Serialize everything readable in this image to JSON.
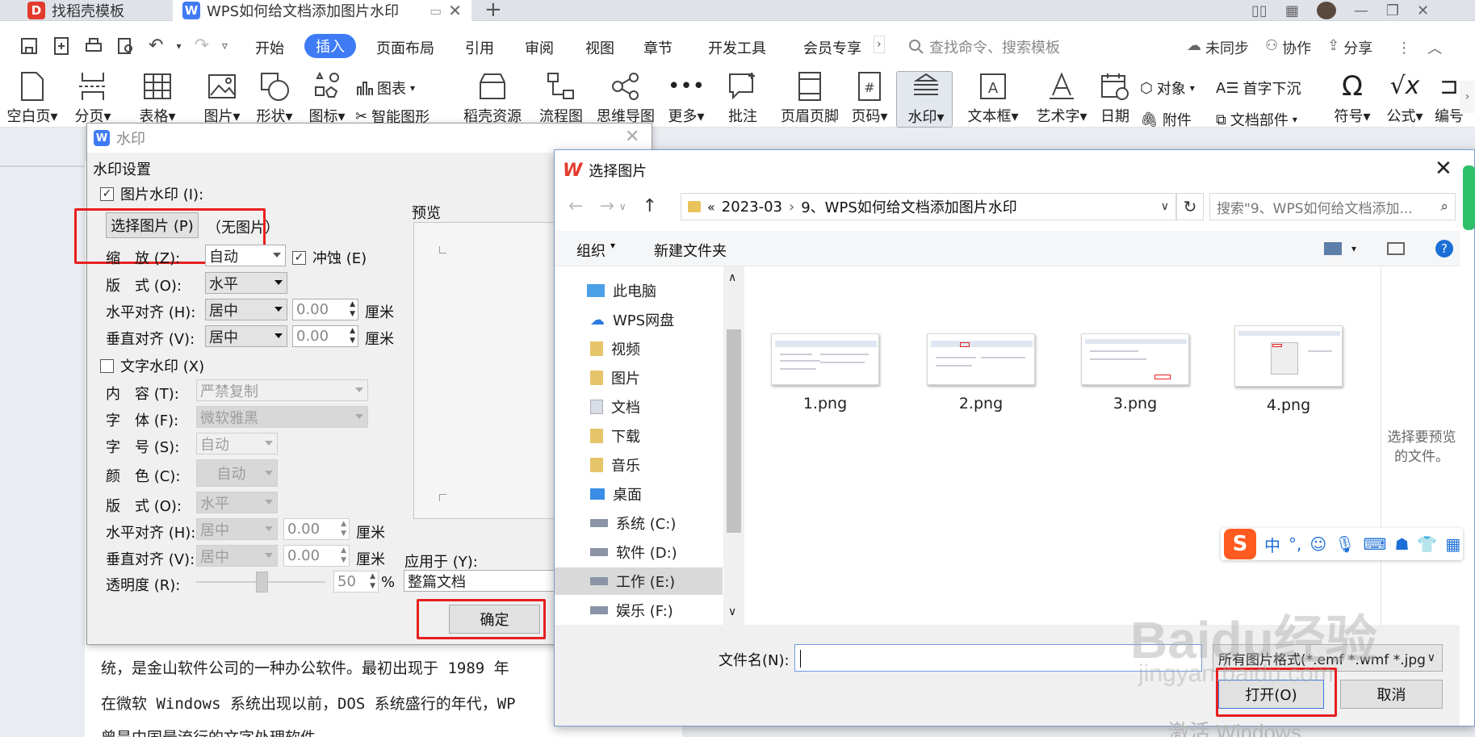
{
  "tabs": [
    {
      "label": "找稻壳模板",
      "logo": "D"
    },
    {
      "label": "WPS如何给文档添加图片水印",
      "logo": "W"
    }
  ],
  "new_tab": "+",
  "menu": [
    "开始",
    "插入",
    "页面布局",
    "引用",
    "审阅",
    "视图",
    "章节",
    "开发工具",
    "会员专享"
  ],
  "menu_active": "插入",
  "search": {
    "placeholder": "查找命令、搜索模板"
  },
  "top_right": {
    "sync": "未同步",
    "collab": "协作",
    "share": "分享"
  },
  "ribbon": {
    "blank_page": "空白页",
    "section": "分页",
    "table": "表格",
    "picture": "图片",
    "shape": "形状",
    "icon": "图标",
    "chart": "图表",
    "smart_graph": "智能图形",
    "docer_res": "稻壳资源",
    "flowchart": "流程图",
    "mindmap": "思维导图",
    "more": "更多",
    "comment": "批注",
    "header_footer": "页眉页脚",
    "page_num": "页码",
    "watermark": "水印",
    "textbox": "文本框",
    "wordart": "艺术字",
    "date": "日期",
    "object": "对象",
    "attachment": "附件",
    "drop_cap": "首字下沉",
    "doc_parts": "文档部件",
    "symbol": "符号",
    "formula": "公式",
    "edit": "编号"
  },
  "watermark_dialog": {
    "title": "水印",
    "settings_label": "水印设置",
    "pic_wm_label": "图片水印 (I):",
    "select_pic_btn": "选择图片 (P)",
    "no_pic": "（无图片）",
    "scale_label": "缩　放 (Z):",
    "scale_value": "自动",
    "washout_label": "冲蚀 (E)",
    "layout_label": "版　式 (O):",
    "layout_value": "水平",
    "halign_label": "水平对齐 (H):",
    "halign_value": "居中",
    "h_offset": "0.00",
    "unit_cm": "厘米",
    "valign_label": "垂直对齐 (V):",
    "valign_value": "居中",
    "v_offset": "0.00",
    "text_wm_label": "文字水印 (X)",
    "content_label": "内　容 (T):",
    "content_value": "严禁复制",
    "font_label": "字　体 (F):",
    "font_value": "微软雅黑",
    "size_label": "字　号 (S):",
    "size_value": "自动",
    "color_label": "颜　色 (C):",
    "color_value": "自动",
    "t_layout_label": "版　式 (O):",
    "t_layout_value": "水平",
    "t_halign_label": "水平对齐 (H):",
    "t_halign_value": "居中",
    "t_h_offset": "0.00",
    "t_valign_label": "垂直对齐 (V):",
    "t_valign_value": "居中",
    "t_v_offset": "0.00",
    "opacity_label": "透明度 (R):",
    "opacity_value": "50",
    "opacity_unit": "%",
    "preview_label": "预览",
    "apply_label": "应用于 (Y):",
    "apply_value": "整篇文档",
    "ok_btn": "确定"
  },
  "file_dialog": {
    "title": "选择图片",
    "breadcrumb": [
      "«",
      "2023-03",
      "9、WPS如何给文档添加图片水印"
    ],
    "search_placeholder": "搜索\"9、WPS如何给文档添加...",
    "organize": "组织",
    "new_folder": "新建文件夹",
    "nav": [
      {
        "label": "此电脑",
        "icon": "computer-icon"
      },
      {
        "label": "WPS网盘",
        "icon": "cloud-icon"
      },
      {
        "label": "视频",
        "icon": "video-folder-icon"
      },
      {
        "label": "图片",
        "icon": "picture-folder-icon"
      },
      {
        "label": "文档",
        "icon": "document-folder-icon"
      },
      {
        "label": "下载",
        "icon": "download-folder-icon"
      },
      {
        "label": "音乐",
        "icon": "music-folder-icon"
      },
      {
        "label": "桌面",
        "icon": "desktop-folder-icon"
      },
      {
        "label": "系统 (C:)",
        "icon": "drive-icon"
      },
      {
        "label": "软件 (D:)",
        "icon": "drive-icon"
      },
      {
        "label": "工作 (E:)",
        "icon": "drive-icon"
      },
      {
        "label": "娱乐 (F:)",
        "icon": "drive-icon"
      }
    ],
    "files": [
      "1.png",
      "2.png",
      "3.png",
      "4.png"
    ],
    "preview_hint": "选择要预览的文件。",
    "filename_label": "文件名(N):",
    "filter_value": "所有图片格式(*.emf *.wmf *.jpg",
    "open_btn": "打开(O)",
    "cancel_btn": "取消"
  },
  "doc_lines": [
    "统，是金山软件公司的一种办公软件。最初出现于 1989 年",
    "在微软 Windows 系统出现以前，DOS 系统盛行的年代，WP",
    "曾是中国最流行的文字处理软件"
  ],
  "ime": {
    "lang": "中",
    "punct": "°,"
  },
  "activation_text": "激活 Windows",
  "baidu_watermark": {
    "text": "Baidu经验",
    "url": "jingyan.baidu.com"
  },
  "colors": {
    "accent": "#3e7bf5",
    "highlight_red": "#e81f1f",
    "wps_red": "#e23b2e",
    "sogou_orange": "#ff5a1f"
  }
}
